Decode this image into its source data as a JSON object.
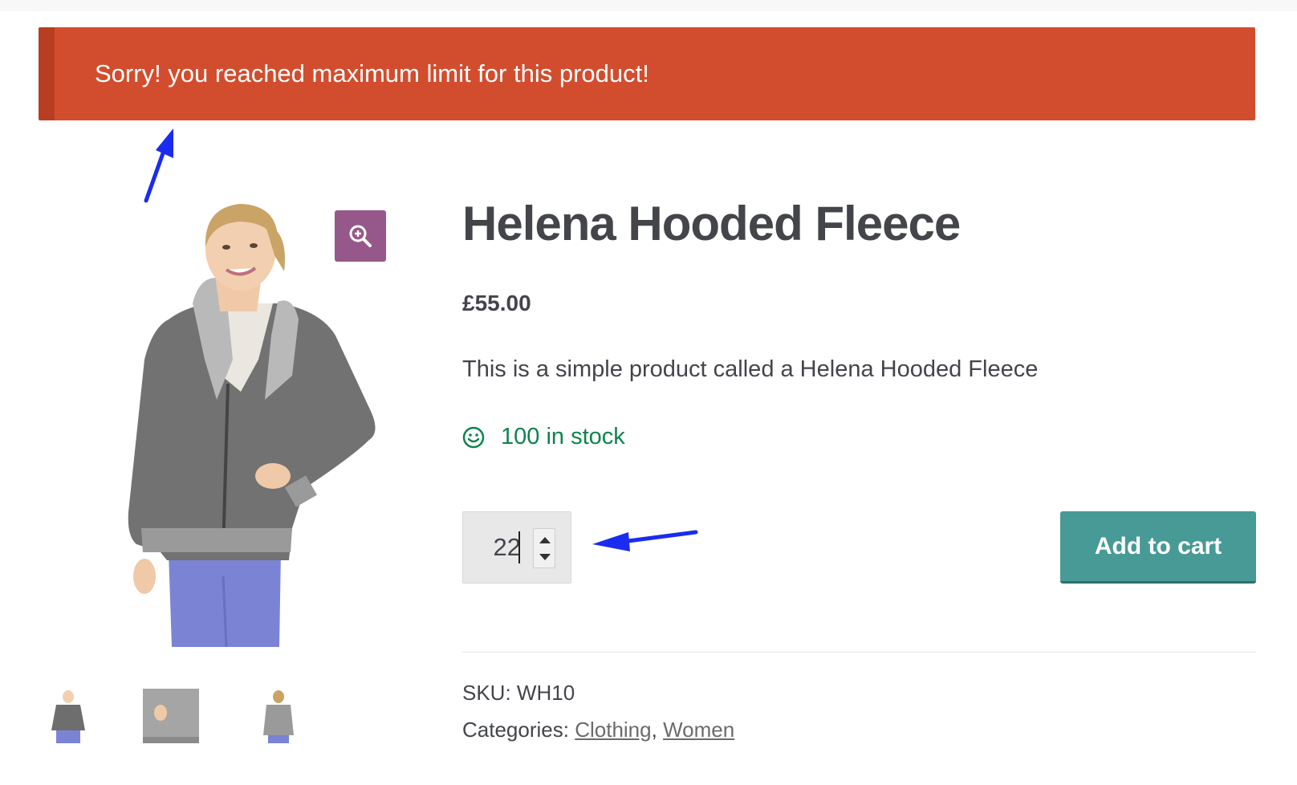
{
  "notice": {
    "message": "Sorry! you reached maximum limit for this product!"
  },
  "product": {
    "title": "Helena Hooded Fleece",
    "price": "£55.00",
    "description": "This is a simple product called a Helena Hooded Fleece",
    "stock": "100 in stock",
    "quantity": "22",
    "add_to_cart_label": "Add to cart",
    "sku_label": "SKU:",
    "sku": "WH10",
    "categories_label": "Categories:",
    "categories": [
      "Clothing",
      "Women"
    ],
    "category_separator": ","
  },
  "icons": {
    "zoom": "zoom-in-icon",
    "stock": "smiley-icon",
    "spin_up": "caret-up-icon",
    "spin_down": "caret-down-icon"
  },
  "colors": {
    "notice_bg": "#d24d2e",
    "zoom_bg": "#96588a",
    "stock_text": "#0f834d",
    "add_to_cart_bg": "#479a96",
    "annotation_arrow": "#1a2cf0"
  }
}
